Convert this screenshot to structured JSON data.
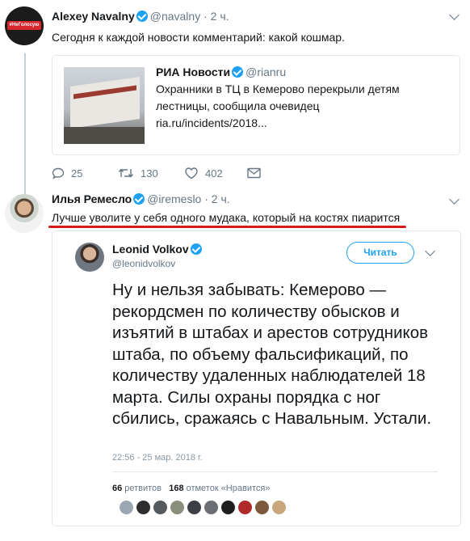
{
  "tweets": [
    {
      "author": "Alexey Navalny",
      "handle": "@navalny",
      "time": "· 2 ч.",
      "text": "Сегодня к каждой новости комментарий: какой кошмар.",
      "avatar_badge": "#НеГолосую",
      "card": {
        "source": "РИА Новости",
        "handle": "@rianru",
        "lines": [
          "Охранники в ТЦ в Кемерово перекрыли детям",
          "лестницы, сообщила очевидец",
          "ria.ru/incidents/2018..."
        ]
      },
      "actions": {
        "replies": "25",
        "retweets": "130",
        "likes": "402"
      }
    },
    {
      "author": "Илья Ремесло",
      "handle": "@iremeslo",
      "time": "· 2 ч.",
      "text": "Лучше уволите у себя одного мудака, который на костях пиарится",
      "embed": {
        "author": "Leonid Volkov",
        "handle": "@leonidvolkov",
        "follow_label": "Читать",
        "text": "Ну и нельзя забывать: Кемерово — рекордсмен по количеству обысков и изъятий в штабах и арестов сотрудников штаба, по объему фальсификаций, по количеству удаленных наблюдателей 18 марта. Силы охраны порядка с ног сбились, сражаясь с Навальным. Устали.",
        "timestamp": "22:56 - 25 мар. 2018 г.",
        "retweets_count": "66",
        "retweets_label": "ретвитов",
        "likes_count": "168",
        "likes_label": "отметок «Нравится»"
      }
    }
  ],
  "colors": {
    "accent": "#1da1f2",
    "underline": "#d21b1b",
    "muted": "#657786"
  }
}
